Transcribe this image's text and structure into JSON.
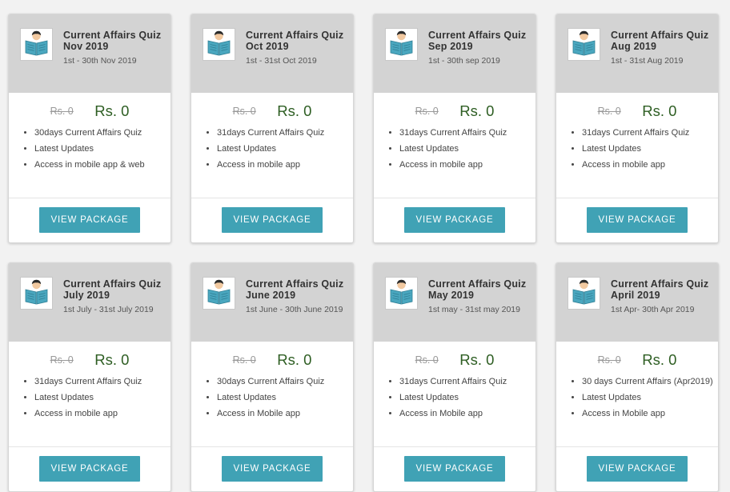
{
  "colors": {
    "header_bg": "#d3d3d3",
    "price_green": "#2e5e23",
    "button_teal": "#40a2b5",
    "old_price_grey": "#999999"
  },
  "cards": [
    {
      "title": "Current Affairs Quiz Nov 2019",
      "dates": "1st - 30th Nov 2019",
      "old_price": "Rs. 0",
      "price": "Rs. 0",
      "features": [
        "30days Current Affairs Quiz",
        "Latest Updates",
        "Access in mobile app & web"
      ],
      "button": "VIEW PACKAGE",
      "icon": "reading-person-icon"
    },
    {
      "title": "Current Affairs Quiz Oct 2019",
      "dates": "1st - 31st Oct 2019",
      "old_price": "Rs. 0",
      "price": "Rs. 0",
      "features": [
        "31days Current Affairs Quiz",
        "Latest Updates",
        "Access in mobile app"
      ],
      "button": "VIEW PACKAGE",
      "icon": "reading-person-icon"
    },
    {
      "title": "Current Affairs Quiz Sep 2019",
      "dates": "1st - 30th sep 2019",
      "old_price": "Rs. 0",
      "price": "Rs. 0",
      "features": [
        "31days Current Affairs Quiz",
        "Latest Updates",
        "Access in mobile app"
      ],
      "button": "VIEW PACKAGE",
      "icon": "reading-person-icon"
    },
    {
      "title": "Current Affairs Quiz Aug 2019",
      "dates": "1st - 31st Aug 2019",
      "old_price": "Rs. 0",
      "price": "Rs. 0",
      "features": [
        "31days Current Affairs Quiz",
        "Latest Updates",
        "Access in mobile app"
      ],
      "button": "VIEW PACKAGE",
      "icon": "reading-person-icon"
    },
    {
      "title": "Current Affairs Quiz July 2019",
      "dates": "1st July - 31st July 2019",
      "old_price": "Rs. 0",
      "price": "Rs. 0",
      "features": [
        "31days Current Affairs Quiz",
        "Latest Updates",
        "Access in mobile app"
      ],
      "button": "VIEW PACKAGE",
      "icon": "reading-person-icon"
    },
    {
      "title": "Current Affairs Quiz June 2019",
      "dates": "1st June - 30th June 2019",
      "old_price": "Rs. 0",
      "price": "Rs. 0",
      "features": [
        "30days Current Affairs Quiz",
        "Latest Updates",
        "Access in Mobile app"
      ],
      "button": "VIEW PACKAGE",
      "icon": "reading-person-icon"
    },
    {
      "title": "Current Affairs Quiz May 2019",
      "dates": "1st may - 31st may 2019",
      "old_price": "Rs. 0",
      "price": "Rs. 0",
      "features": [
        "31days Current Affairs Quiz",
        "Latest Updates",
        "Access in Mobile app"
      ],
      "button": "VIEW PACKAGE",
      "icon": "reading-person-icon"
    },
    {
      "title": "Current Affairs Quiz April 2019",
      "dates": "1st Apr- 30th Apr 2019",
      "old_price": "Rs. 0",
      "price": "Rs. 0",
      "features": [
        "30 days Current Affairs (Apr2019)",
        "Latest Updates",
        "Access in Mobile app"
      ],
      "button": "VIEW PACKAGE",
      "icon": "reading-person-icon"
    }
  ]
}
